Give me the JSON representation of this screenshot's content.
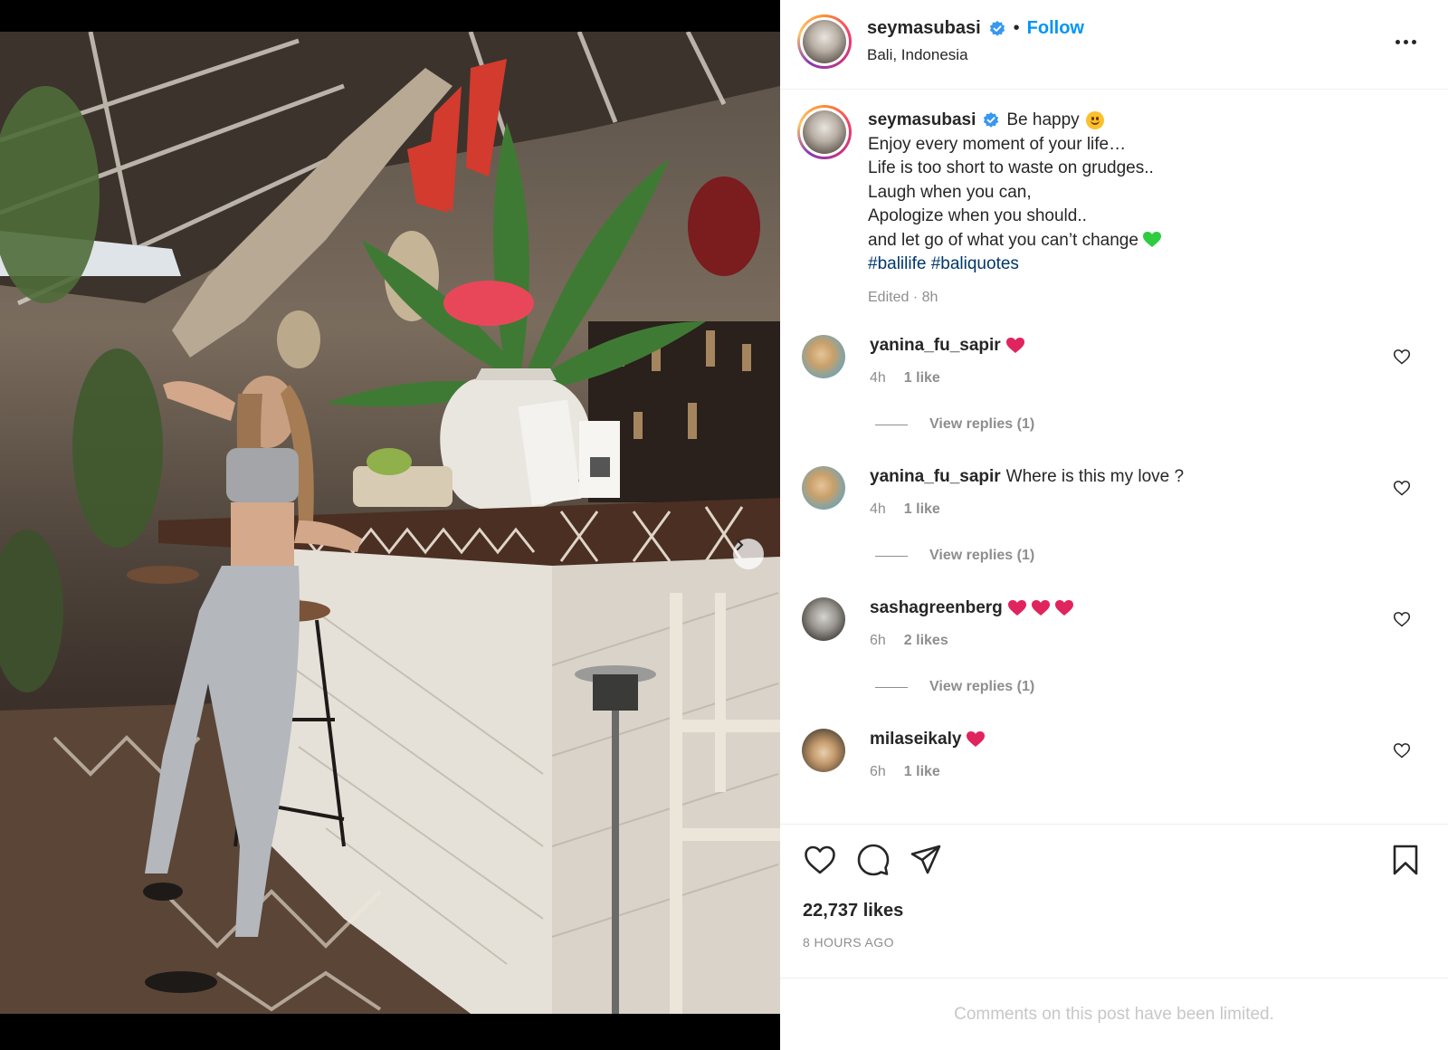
{
  "post": {
    "username": "seymasubasi",
    "follow_label": "Follow",
    "separator": "•",
    "location": "Bali, Indonesia",
    "media_dots": 9,
    "media_active_dot": 0
  },
  "caption": {
    "username": "seymasubasi",
    "first_line": "Be happy",
    "lines": [
      "Enjoy every moment of your life…",
      "Life is too short to waste on grudges..",
      "Laugh when you can,",
      "Apologize when you should..",
      "and let go of what you can’t change"
    ],
    "hashtags": [
      "#balilife",
      "#baliquotes"
    ],
    "meta": "Edited · 8h"
  },
  "comments": [
    {
      "username": "yanina_fu_sapir",
      "text": "",
      "hearts": 1,
      "heart_color": "red",
      "time": "4h",
      "likes": "1 like",
      "replies": "View replies (1)"
    },
    {
      "username": "yanina_fu_sapir",
      "text": "Where is this my love ?",
      "hearts": 0,
      "heart_color": "",
      "time": "4h",
      "likes": "1 like",
      "replies": "View replies (1)"
    },
    {
      "username": "sashagreenberg",
      "text": "",
      "hearts": 3,
      "heart_color": "red",
      "time": "6h",
      "likes": "2 likes",
      "replies": "View replies (1)"
    },
    {
      "username": "milaseikaly",
      "text": "",
      "hearts": 1,
      "heart_color": "red",
      "time": "6h",
      "likes": "1 like",
      "replies": ""
    }
  ],
  "engagement": {
    "likes": "22,737 likes",
    "time_ago": "8 HOURS AGO",
    "limited_notice": "Comments on this post have been limited."
  },
  "icons": {
    "verified": "verified-badge-icon",
    "more": "more-options-icon",
    "like": "heart-icon",
    "comment": "comment-bubble-icon",
    "share": "paper-plane-icon",
    "save": "bookmark-icon",
    "next": "chevron-right-icon"
  },
  "colors": {
    "accent": "#0095f6",
    "hashtag": "#00376b",
    "verified": "#3897f0",
    "meta_gray": "#8e8e8e",
    "heart_red": "#e0245e",
    "heart_green": "#2ecc40"
  }
}
